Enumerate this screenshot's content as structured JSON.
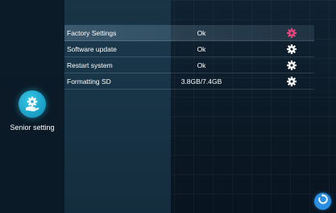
{
  "sidebar": {
    "senior_setting_label": "Senior setting",
    "senior_setting_icon": "hand-gear-icon"
  },
  "settings": {
    "rows": [
      {
        "label": "Factory Settings",
        "value": "Ok",
        "icon": "gear-icon",
        "selected": true
      },
      {
        "label": "Software update",
        "value": "Ok",
        "icon": "gear-icon",
        "selected": false
      },
      {
        "label": "Restart system",
        "value": "Ok",
        "icon": "gear-icon",
        "selected": false
      },
      {
        "label": "Formatting SD",
        "value": "3.8GB/7.4GB",
        "icon": "gear-icon",
        "selected": false
      }
    ]
  },
  "controls": {
    "back_icon": "refresh-back-icon"
  },
  "colors": {
    "accent": "#1ea5cc",
    "gear_active": "#e8457c",
    "gear_inactive": "#ffffff",
    "back_button": "#2a8fe0"
  }
}
